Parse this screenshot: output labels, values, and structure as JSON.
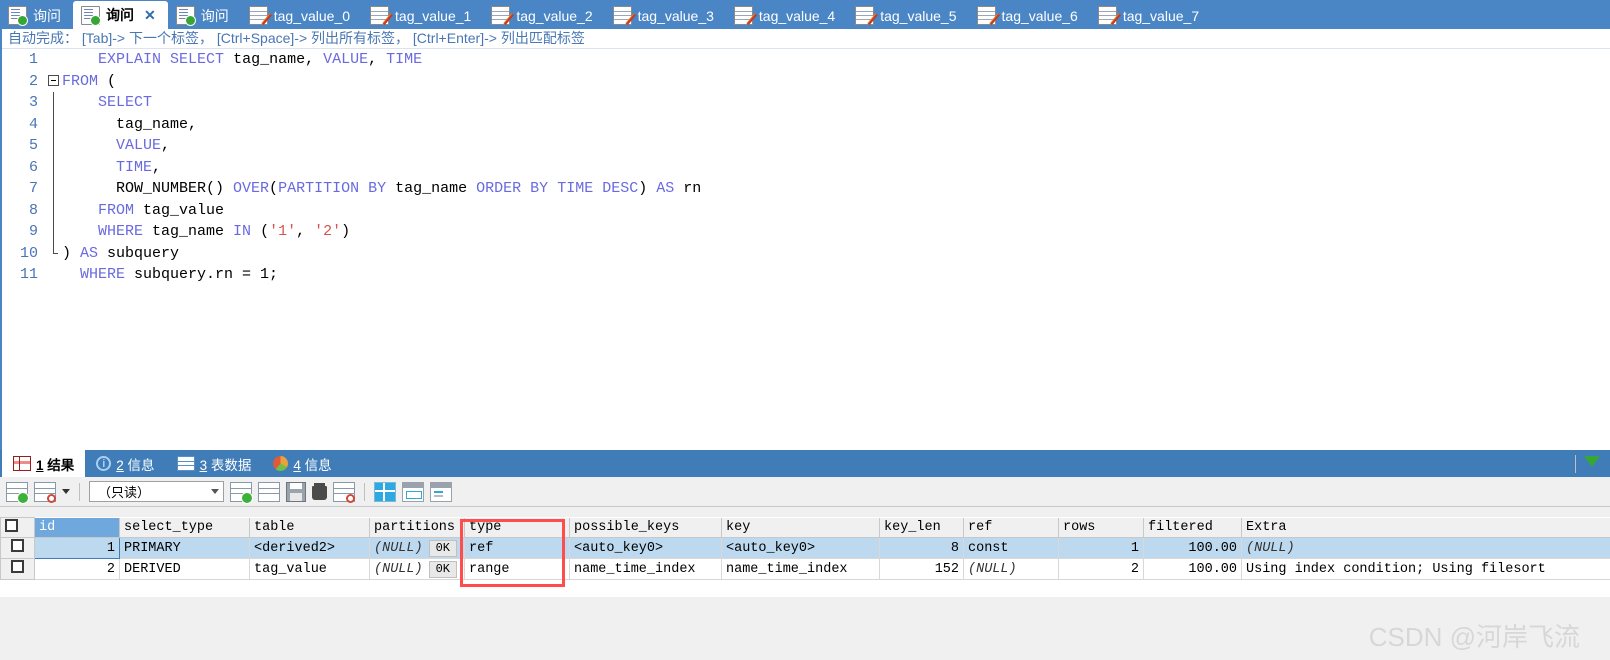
{
  "window": {
    "tabs": [
      {
        "label": "询问",
        "icon": "query-icon",
        "active": false,
        "closable": false
      },
      {
        "label": "询问",
        "icon": "query-icon",
        "active": true,
        "closable": true
      },
      {
        "label": "询问",
        "icon": "query-icon",
        "active": false,
        "closable": false
      },
      {
        "label": "tag_value_0",
        "icon": "table-edit-icon",
        "active": false,
        "closable": false
      },
      {
        "label": "tag_value_1",
        "icon": "table-edit-icon",
        "active": false,
        "closable": false
      },
      {
        "label": "tag_value_2",
        "icon": "table-edit-icon",
        "active": false,
        "closable": false
      },
      {
        "label": "tag_value_3",
        "icon": "table-edit-icon",
        "active": false,
        "closable": false
      },
      {
        "label": "tag_value_4",
        "icon": "table-edit-icon",
        "active": false,
        "closable": false
      },
      {
        "label": "tag_value_5",
        "icon": "table-edit-icon",
        "active": false,
        "closable": false
      },
      {
        "label": "tag_value_6",
        "icon": "table-edit-icon",
        "active": false,
        "closable": false
      },
      {
        "label": "tag_value_7",
        "icon": "table-edit-icon",
        "active": false,
        "closable": false
      }
    ],
    "close_glyph": "✕"
  },
  "editor": {
    "hint_prefix": "自动完成：",
    "hint_parts": [
      "[Tab]-> 下一个标签，",
      "[Ctrl+Space]-> 列出所有标签，",
      "[Ctrl+Enter]-> 列出匹配标签"
    ],
    "hint_full": "自动完成： [Tab]-> 下一个标签， [Ctrl+Space]-> 列出所有标签， [Ctrl+Enter]-> 列出匹配标签",
    "lines": [
      {
        "no": "1",
        "text": "    EXPLAIN SELECT tag_name, VALUE, TIME"
      },
      {
        "no": "2",
        "text": "FROM ("
      },
      {
        "no": "3",
        "text": "    SELECT"
      },
      {
        "no": "4",
        "text": "      tag_name,"
      },
      {
        "no": "5",
        "text": "      VALUE,"
      },
      {
        "no": "6",
        "text": "      TIME,"
      },
      {
        "no": "7",
        "text": "      ROW_NUMBER() OVER(PARTITION BY tag_name ORDER BY TIME DESC) AS rn"
      },
      {
        "no": "8",
        "text": "    FROM tag_value"
      },
      {
        "no": "9",
        "text": "    WHERE tag_name IN ('1', '2')"
      },
      {
        "no": "10",
        "text": ") AS subquery"
      },
      {
        "no": "11",
        "text": "  WHERE subquery.rn = 1;"
      }
    ]
  },
  "result_panel": {
    "tabs": [
      {
        "num": "1",
        "label": "结果",
        "icon": "result-grid-icon",
        "active": true
      },
      {
        "num": "2",
        "label": "信息",
        "icon": "info-icon",
        "active": false
      },
      {
        "num": "3",
        "label": "表数据",
        "icon": "table-data-icon",
        "active": false
      },
      {
        "num": "4",
        "label": "信息",
        "icon": "pie-chart-icon",
        "active": false
      }
    ],
    "toolbar": {
      "mode_select_value": "（只读）",
      "buttons": [
        "new-record-icon",
        "grid-dropdown-icon",
        "add-record-icon",
        "apply-changes-icon",
        "save-icon",
        "delete-icon",
        "cancel-record-icon",
        "grid-view-icon",
        "form-view-icon",
        "detail-view-icon",
        "filter-icon"
      ]
    }
  },
  "grid": {
    "columns": [
      "id",
      "select_type",
      "table",
      "partitions",
      "type",
      "possible_keys",
      "key",
      "key_len",
      "ref",
      "rows",
      "filtered",
      "Extra"
    ],
    "rows": [
      {
        "id": "1",
        "select_type": "PRIMARY",
        "table": "<derived2>",
        "partitions": "(NULL)",
        "partitions_btn": "0K",
        "type": "ref",
        "possible_keys": "<auto_key0>",
        "key": "<auto_key0>",
        "key_len": "8",
        "ref": "const",
        "rows": "1",
        "filtered": "100.00",
        "Extra": "(NULL)",
        "selected": true
      },
      {
        "id": "2",
        "select_type": "DERIVED",
        "table": "tag_value",
        "partitions": "(NULL)",
        "partitions_btn": "0K",
        "type": "range",
        "possible_keys": "name_time_index",
        "key": "name_time_index",
        "key_len": "152",
        "ref": "(NULL)",
        "rows": "2",
        "filtered": "100.00",
        "Extra": "Using index condition; Using filesort",
        "selected": false
      }
    ],
    "highlight_column": "type",
    "highlight_color": "#ff4d4d"
  },
  "watermark": {
    "text": "CSDN @河岸飞流"
  },
  "colors": {
    "tabbar_bg": "#4a86c5",
    "result_tabbar_bg": "#3f7cb8",
    "selected_row": "#bcd9f0",
    "id_header": "#6fa8dc",
    "keyword": "#6a6ae0",
    "string": "#d9534f"
  }
}
